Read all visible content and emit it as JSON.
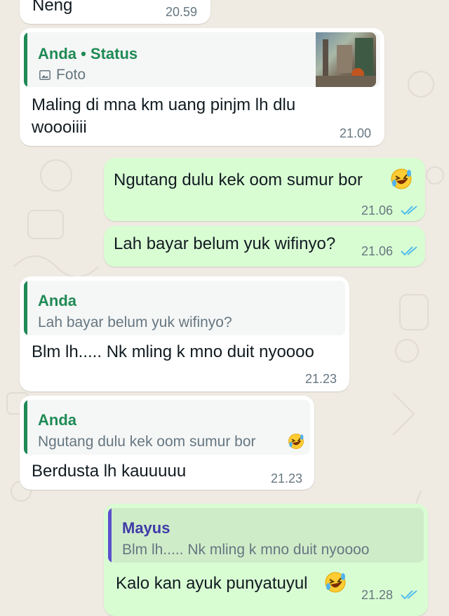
{
  "messages": [
    {
      "text": "Neng",
      "time": "20.59"
    },
    {
      "quote": {
        "author": "Anda • Status",
        "type_label": "Foto"
      },
      "text": "Maling di mna km uang pinjm lh dlu\nwoooiiii",
      "time": "21.00"
    },
    {
      "text": "Ngutang dulu kek oom sumur bor",
      "time": "21.06"
    },
    {
      "text": "Lah bayar belum yuk wifinyo?",
      "time": "21.06"
    },
    {
      "quote": {
        "author": "Anda",
        "text": "Lah bayar belum yuk wifinyo?"
      },
      "text": "Blm lh..... Nk mling k mno duit nyoooo",
      "time": "21.23"
    },
    {
      "quote": {
        "author": "Anda",
        "text": "Ngutang dulu kek oom sumur bor"
      },
      "text": "Berdusta lh kauuuuu",
      "time": "21.23"
    },
    {
      "quote": {
        "author": "Mayus",
        "text": "Blm lh..... Nk mling k mno duit nyoooo"
      },
      "text": "Kalo kan ayuk punyatuyul",
      "time": "21.28"
    }
  ],
  "colors": {
    "incoming_bubble": "#ffffff",
    "outgoing_bubble": "#d9fdd3",
    "quote_anda": "#1f8a55",
    "quote_mayus": "#5b4fcf",
    "read_ticks": "#53bdeb"
  },
  "icons": {
    "laughing": "rolling-on-floor-laughing-emoji",
    "photo": "photo-icon",
    "read": "double-check-icon"
  }
}
